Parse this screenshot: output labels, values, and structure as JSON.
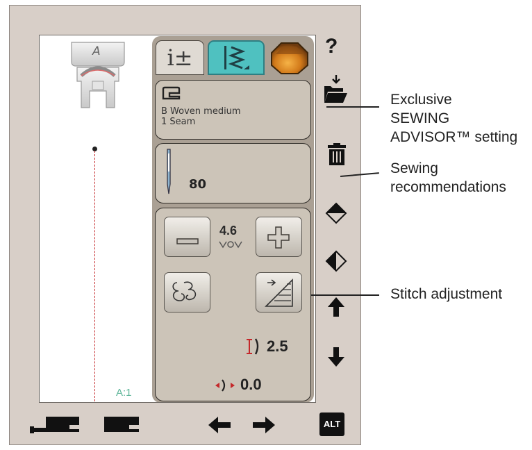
{
  "screen": {
    "presser_foot": {
      "letter": "A"
    },
    "stitch_id": "A:1",
    "tabs": [
      {
        "name": "info",
        "label": "i±"
      },
      {
        "name": "stitch",
        "label": ""
      },
      {
        "name": "jewel",
        "label": ""
      }
    ],
    "fabric": {
      "type": "B Woven medium",
      "technique": "1 Seam"
    },
    "needle": {
      "size": "80"
    },
    "stitch": {
      "width": "4.6",
      "length": "2.5",
      "position": "0.0"
    }
  },
  "side_icons": [
    "help-icon",
    "save-folder-icon",
    "delete-icon",
    "mirror-side-icon",
    "mirror-end-icon",
    "arrow-up-icon",
    "arrow-down-icon"
  ],
  "bottom_bar": {
    "alt_label": "ALT"
  },
  "annotations": {
    "advisor": "Exclusive\nSEWING\nADVISOR™ setting",
    "recommendations": "Sewing\nrecommendations",
    "adjustment": "Stitch adjustment"
  },
  "colors": {
    "teal": "#4fc1c0",
    "panel": "#aaa094",
    "device": "#d8cfc8"
  }
}
